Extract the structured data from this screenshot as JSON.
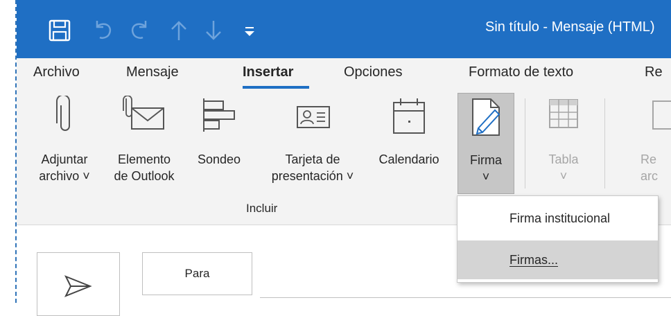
{
  "title_bar": {
    "window_title": "Sin título  -  Mensaje (HTML)",
    "quick_access": [
      "save-icon",
      "undo-icon",
      "redo-icon",
      "up-arrow-icon",
      "down-arrow-icon",
      "customize-toolbar-icon"
    ]
  },
  "ribbon": {
    "tabs": [
      {
        "label": "Archivo"
      },
      {
        "label": "Mensaje"
      },
      {
        "label": "Insertar",
        "active": true
      },
      {
        "label": "Opciones"
      },
      {
        "label": "Formato de texto"
      },
      {
        "label": "Re"
      }
    ],
    "buttons": {
      "adjuntar": {
        "line1": "Adjuntar",
        "line2": "archivo ˅"
      },
      "elemento": {
        "line1": "Elemento",
        "line2": "de Outlook"
      },
      "sondeo": {
        "line1": "Sondeo",
        "line2": ""
      },
      "tarjeta": {
        "line1": "Tarjeta de",
        "line2": "presentación ˅"
      },
      "calendario": {
        "line1": "Calendario",
        "line2": ""
      },
      "firma": {
        "line1": "Firma",
        "line2": "˅"
      },
      "tabla": {
        "line1": "Tabla",
        "line2": "˅"
      },
      "partial": {
        "line1": "Re",
        "line2": "arc"
      }
    },
    "group_label": "Incluir"
  },
  "compose": {
    "to_label": "Para"
  },
  "signature_menu": {
    "items": [
      {
        "label": "Firma institucional"
      },
      {
        "label": "Firmas..."
      }
    ]
  },
  "colors": {
    "title_bar": "#1f6fc4",
    "ribbon": "#f3f3f3",
    "accent": "#1f6fc4",
    "firma_pressed": "#c6c6c6",
    "menu_hover": "#d4d4d4"
  }
}
